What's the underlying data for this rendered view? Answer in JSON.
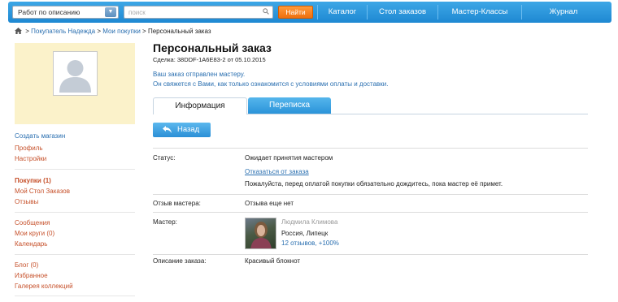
{
  "header": {
    "search_scope": "Работ по описанию",
    "search_placeholder": "поиск",
    "find_label": "Найти",
    "nav": [
      "Каталог",
      "Стол заказов",
      "Мастер-Классы",
      "Журнал"
    ]
  },
  "breadcrumb": {
    "items": [
      "Покупатель Надежда",
      "Мои покупки"
    ],
    "current": "Персональный заказ",
    "separator": ">"
  },
  "sidebar": {
    "avatar_alt": "user-avatar-placeholder",
    "group1": [
      "Создать магазин",
      "Профиль",
      "Настройки"
    ],
    "group2": [
      "Покупки (1)",
      "Мой Стол Заказов",
      "Отзывы"
    ],
    "group3": [
      "Сообщения",
      "Мои круги (0)",
      "Календарь"
    ],
    "group4": [
      "Блог (0)",
      "Избранное",
      "Галерея коллекций"
    ]
  },
  "main": {
    "title": "Персональный заказ",
    "deal": "Сделка: 38DDF-1A6E83-2 от 05.10.2015",
    "notice_line1": "Ваш заказ отправлен мастеру.",
    "notice_line2": "Он свяжется с Вами, как только ознакомится с условиями оплаты и доставки.",
    "tabs": [
      "Информация",
      "Переписка"
    ],
    "back_label": "Назад",
    "status_label": "Статус:",
    "status_value": "Ожидает принятия мастером",
    "cancel_link": "Отказаться от заказа",
    "status_note": "Пожалуйста, перед оплатой покупки обязательно дождитесь, пока мастер её примет.",
    "review_label": "Отзыв мастера:",
    "review_value": "Отзыва еще нет",
    "master_label": "Мастер:",
    "master_name": "Людмила Климова",
    "master_city": "Россия, Липецк",
    "master_reviews": "12 отзывов, +100%",
    "description_label": "Описание заказа:",
    "description_value": "Красивый блокнот"
  },
  "colors": {
    "topbar": "#1e88d2",
    "find_button": "#ef6f0e",
    "link": "#2a6fb0",
    "side_link": "#c6502a",
    "profile_bg": "#fbf2ca"
  }
}
